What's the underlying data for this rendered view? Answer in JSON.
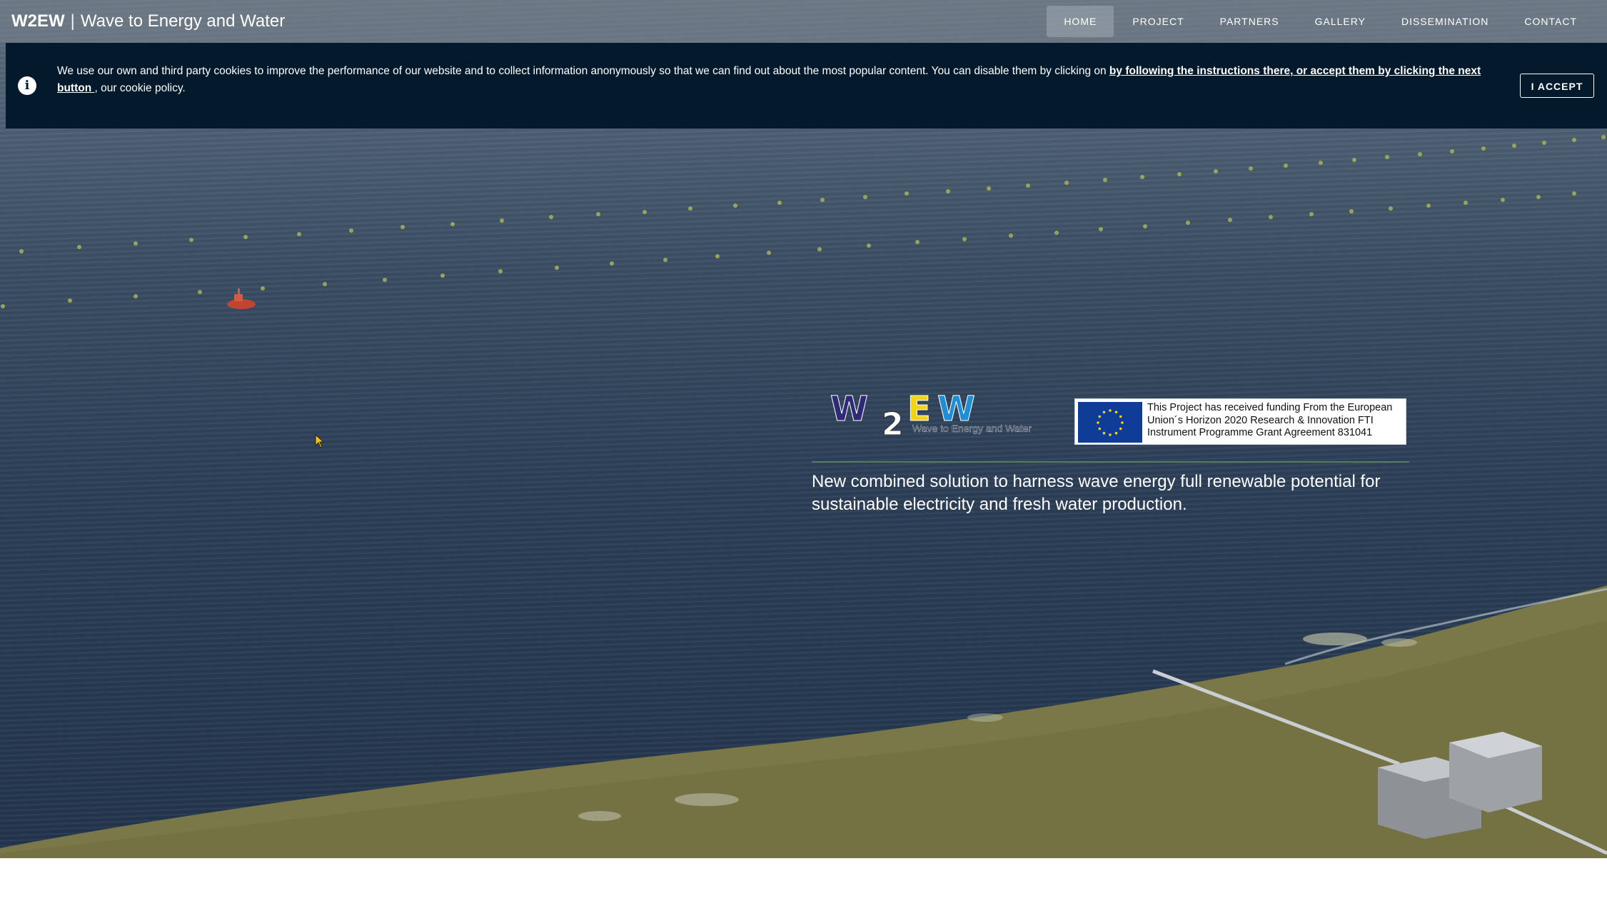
{
  "header": {
    "brand_short": "W2EW",
    "brand_separator": "|",
    "brand_full": "Wave to Energy and Water"
  },
  "nav": {
    "items": [
      {
        "label": "HOME",
        "active": true
      },
      {
        "label": "PROJECT"
      },
      {
        "label": "PARTNERS"
      },
      {
        "label": "GALLERY"
      },
      {
        "label": "DISSEMINATION"
      },
      {
        "label": "CONTACT"
      }
    ]
  },
  "cookie": {
    "icon": "info-icon",
    "text_before": "We use our own and third party cookies to improve the performance of our website and to collect information anonymously so that we can find out about the most popular content. You can disable them by clicking on ",
    "link_text": "by following the instructions there, or accept them by clicking the next button ",
    "text_after": ", our cookie policy.",
    "accept_label": "I ACCEPT"
  },
  "hero": {
    "logo": {
      "wordmark": "W2EW",
      "subtitle": "Wave to Energy and Water",
      "colors": {
        "w": "#2e2a78",
        "two": "#ffffff",
        "e": "#f2d21b",
        "w2": "#1e8fd6"
      }
    },
    "eu_funding_text": "This Project has received funding From the European Union´s Horizon 2020 Research & Innovation FTI Instrument Programme Grant Agreement 831041",
    "tagline": "New combined solution to harness wave energy full renewable potential for sustainable electricity and fresh water production."
  },
  "colors": {
    "cookie_bg": "#021a2c",
    "sea": "#2b3e56",
    "land": "#7c7a45"
  }
}
